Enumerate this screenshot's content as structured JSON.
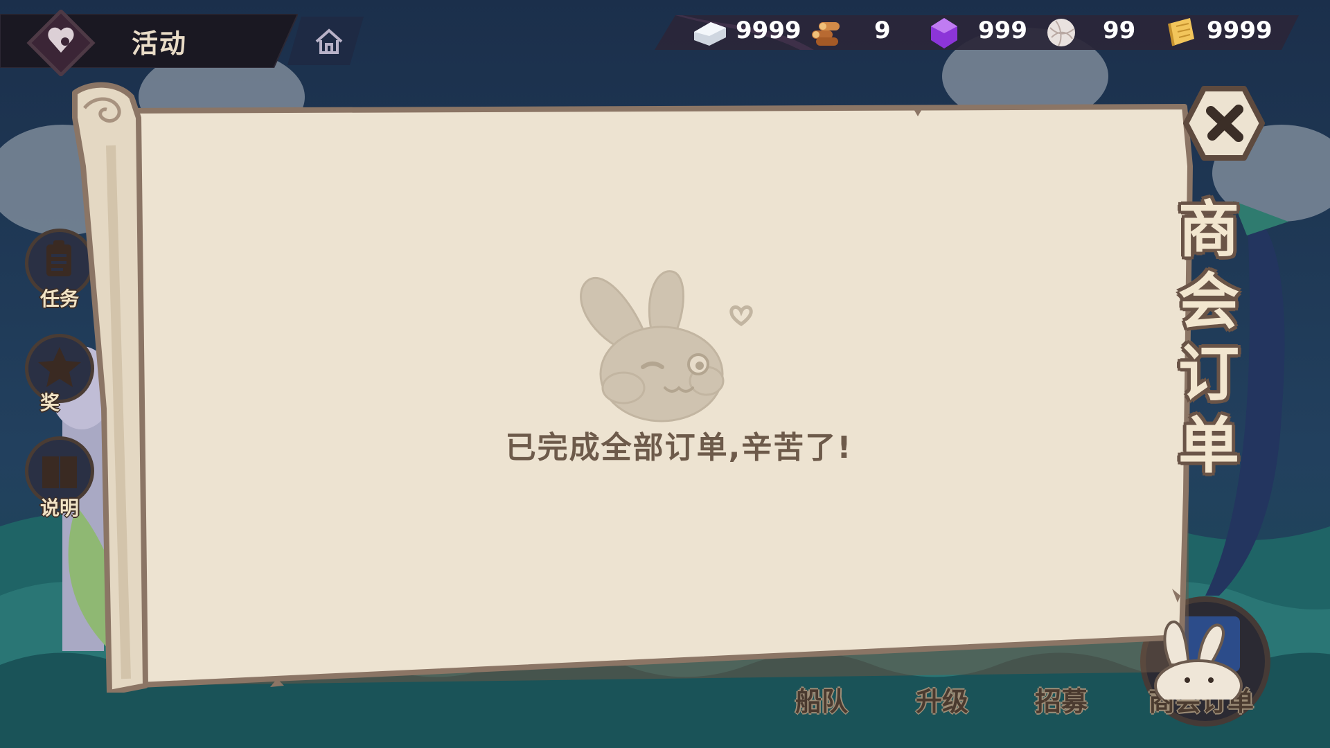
{
  "header": {
    "title": "活动",
    "back_icon": "heart-badge-icon",
    "home_icon": "home-icon"
  },
  "resources": [
    {
      "icon": "silver-ingot-icon",
      "value": "9999"
    },
    {
      "icon": "wood-logs-icon",
      "value": "9"
    },
    {
      "icon": "purple-gem-icon",
      "value": "999"
    },
    {
      "icon": "yarn-ball-icon",
      "value": "99"
    },
    {
      "icon": "scroll-ticket-icon",
      "value": "9999"
    }
  ],
  "side_menu": [
    {
      "label": "任务",
      "icon": "clipboard-icon"
    },
    {
      "label": "奖",
      "icon": "star-badge-icon"
    },
    {
      "label": "说明",
      "icon": "book-icon"
    }
  ],
  "bottom_menu": [
    {
      "label": "船队"
    },
    {
      "label": "升级"
    },
    {
      "label": "招募"
    },
    {
      "label": "商会订单"
    }
  ],
  "panel": {
    "title_chars": [
      "商",
      "会",
      "订",
      "单"
    ],
    "message": "已完成全部订单,辛苦了!",
    "close_icon": "close-x-icon",
    "illustration": "winking-bunny-icon"
  },
  "colors": {
    "parchment": "#ede2d0",
    "parchment_edge": "#d9cbb3",
    "frame": "#8b7565",
    "text": "#6d5a4a",
    "sky": "#1d3452",
    "sea": "#1e5a63"
  }
}
